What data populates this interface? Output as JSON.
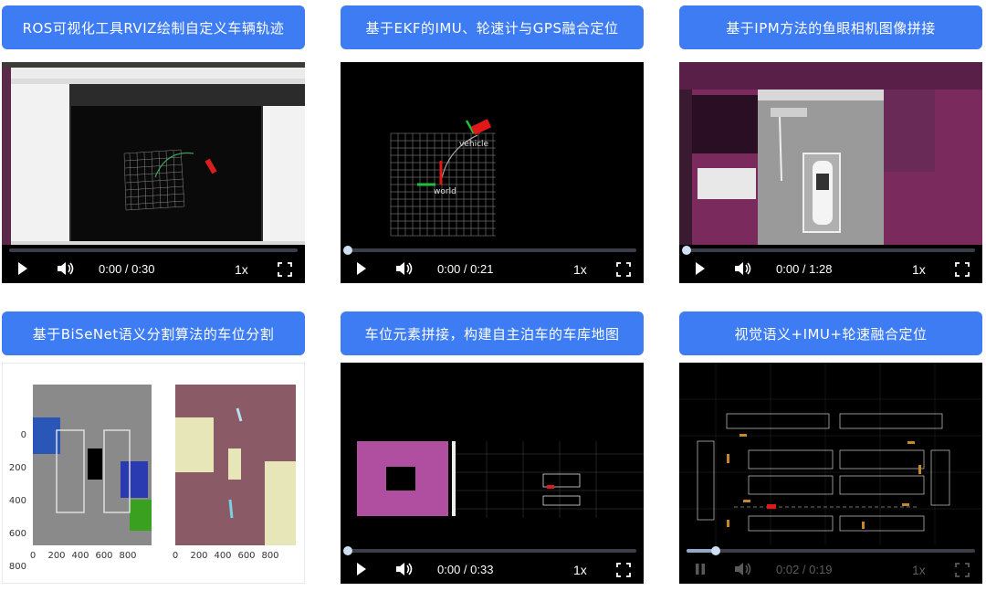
{
  "cards": [
    {
      "title": "ROS可视化工具RVIZ绘制自定义车辆轨迹",
      "time": "0:00 / 0:30",
      "speed": "1x",
      "progress": 0.0
    },
    {
      "title": "基于EKF的IMU、轮速计与GPS融合定位",
      "time": "0:00 / 0:21",
      "speed": "1x",
      "progress": 0.0,
      "labels": {
        "vehicle": "vehicle",
        "world": "world"
      }
    },
    {
      "title": "基于IPM方法的鱼眼相机图像拼接",
      "time": "0:00 / 1:28",
      "speed": "1x",
      "progress": 0.0
    },
    {
      "title": "基于BiSeNet语义分割算法的车位分割",
      "plot": {
        "yticks": [
          "0",
          "200",
          "400",
          "600",
          "800"
        ],
        "xticks": [
          "0",
          "200",
          "400",
          "600",
          "800"
        ]
      }
    },
    {
      "title": "车位元素拼接，构建自主泊车的车库地图",
      "time": "0:00 / 0:33",
      "speed": "1x",
      "progress": 0.0
    },
    {
      "title": "视觉语义+IMU+轮速融合定位",
      "time": "0:02 / 0:19",
      "speed": "1x",
      "progress": 0.1
    }
  ],
  "colors": {
    "title_bg": "#3d7cf3",
    "player_bg": "#000000",
    "progress_fill": "#8fa9c9"
  }
}
